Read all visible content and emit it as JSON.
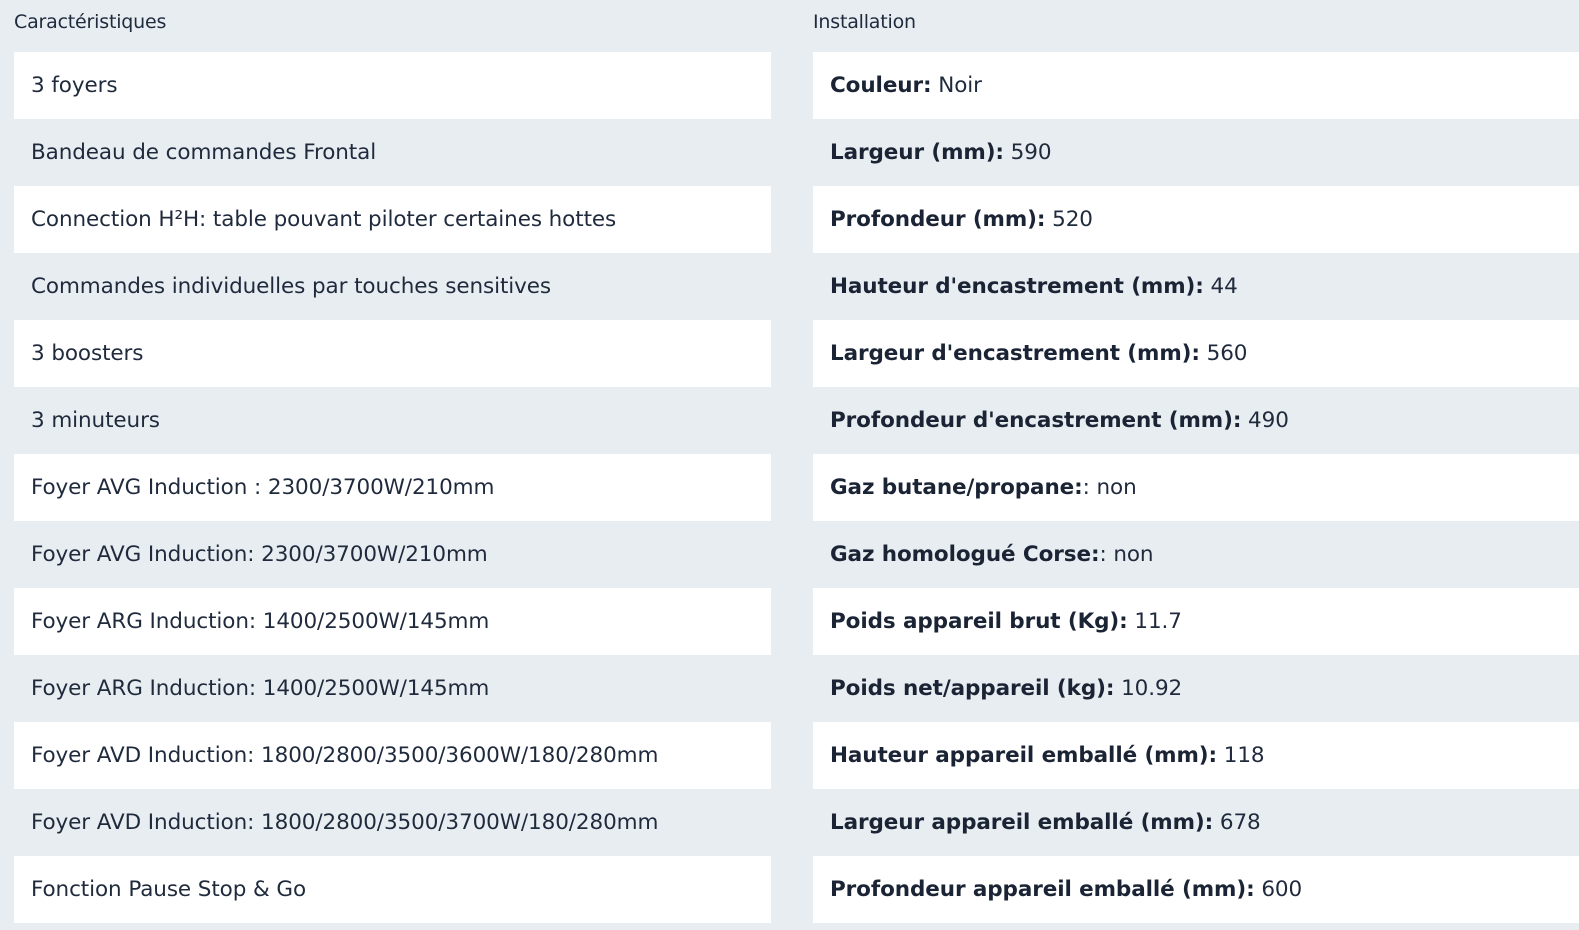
{
  "features": {
    "title": "Caractéristiques",
    "items": [
      "3 foyers",
      "Bandeau de commandes Frontal",
      "Connection H²H: table pouvant piloter certaines hottes",
      "Commandes individuelles par touches sensitives",
      "3 boosters",
      "3 minuteurs",
      "Foyer AVG Induction : 2300/3700W/210mm",
      "Foyer AVG Induction: 2300/3700W/210mm",
      "Foyer ARG Induction: 1400/2500W/145mm",
      "Foyer ARG Induction: 1400/2500W/145mm",
      "Foyer AVD Induction: 1800/2800/3500/3600W/180/280mm",
      "Foyer AVD Induction: 1800/2800/3500/3700W/180/280mm",
      "Fonction Pause Stop & Go"
    ]
  },
  "installation": {
    "title": "Installation",
    "specs": [
      {
        "label": "Couleur:",
        "value": " Noir"
      },
      {
        "label": "Largeur (mm):",
        "value": " 590"
      },
      {
        "label": "Profondeur (mm):",
        "value": " 520"
      },
      {
        "label": "Hauteur d'encastrement (mm):",
        "value": " 44"
      },
      {
        "label": "Largeur d'encastrement (mm):",
        "value": " 560"
      },
      {
        "label": "Profondeur d'encastrement (mm):",
        "value": " 490"
      },
      {
        "label": "Gaz butane/propane:",
        "value": ": non"
      },
      {
        "label": "Gaz homologué Corse:",
        "value": ": non"
      },
      {
        "label": "Poids appareil brut (Kg):",
        "value": " 11.7"
      },
      {
        "label": "Poids net/appareil (kg):",
        "value": " 10.92"
      },
      {
        "label": "Hauteur appareil emballé (mm):",
        "value": " 118"
      },
      {
        "label": "Largeur appareil emballé (mm):",
        "value": " 678"
      },
      {
        "label": "Profondeur appareil emballé (mm):",
        "value": " 600"
      }
    ]
  }
}
